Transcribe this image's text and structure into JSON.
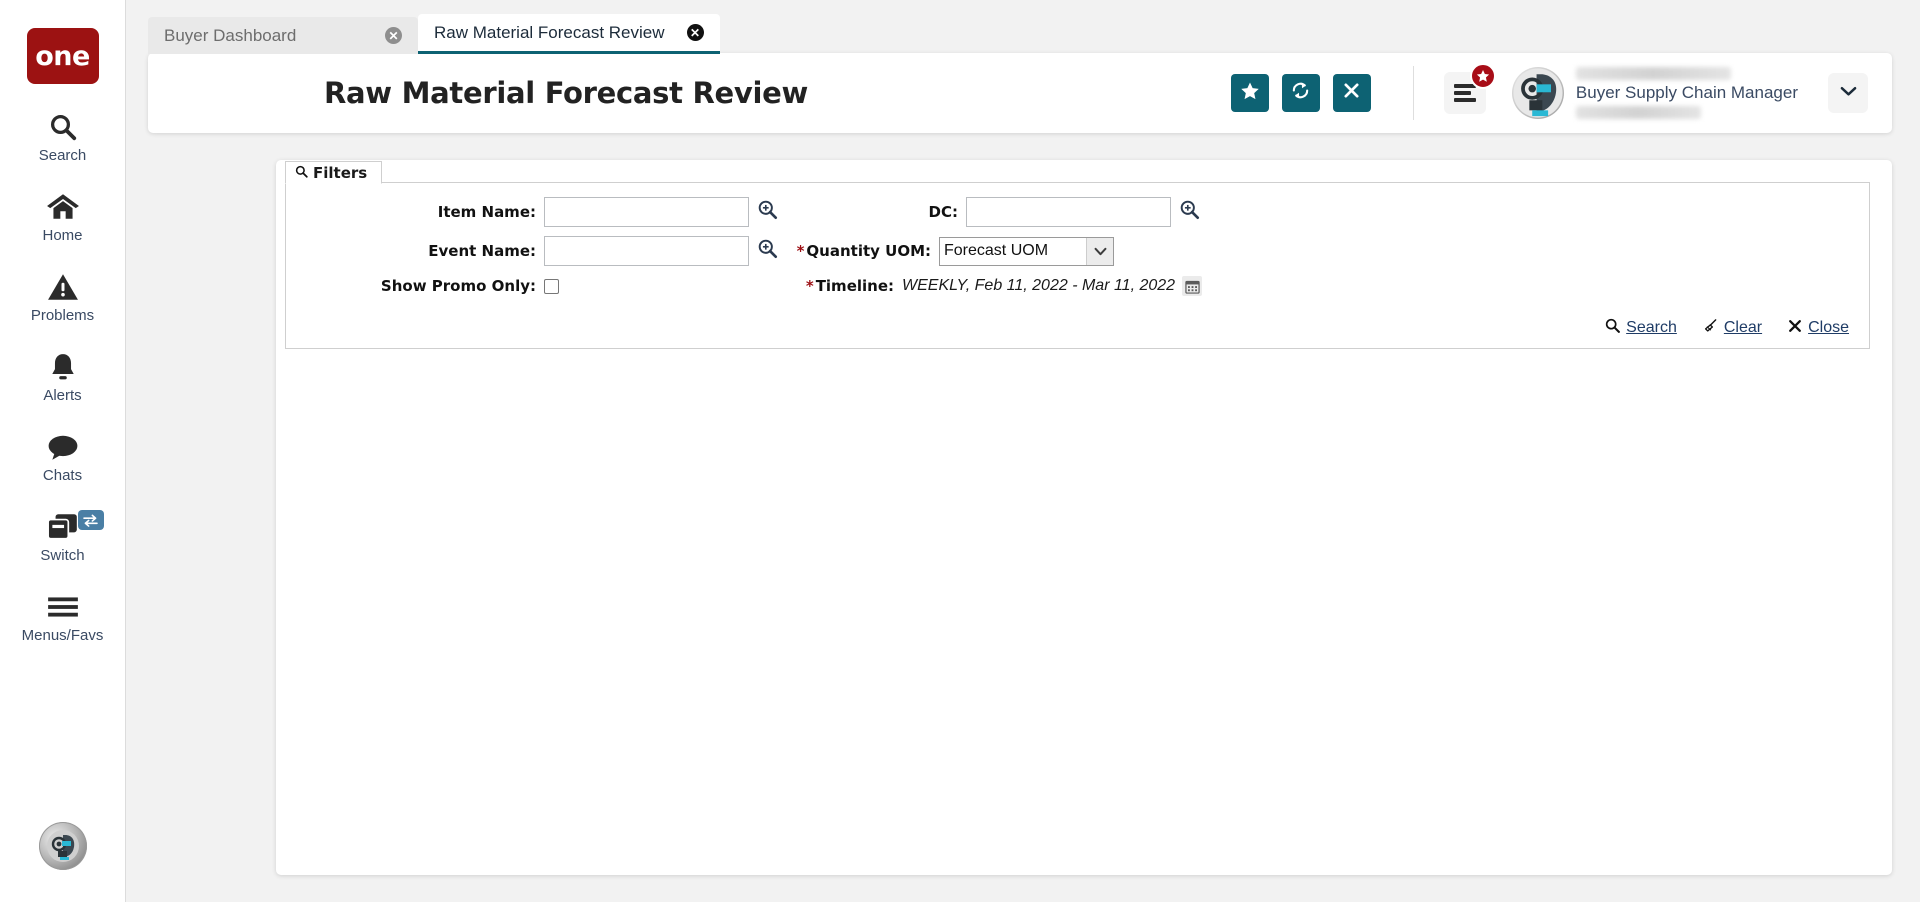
{
  "brand": {
    "logo_text": "one",
    "logo_color": "#9c1212"
  },
  "theme": {
    "accent_teal": "#0d6273",
    "link_blue": "#1f3c66",
    "required_red": "#9c0e13",
    "badge_red": "#a80d17"
  },
  "sidebar": {
    "items": [
      {
        "label": "Search",
        "icon": "search-icon"
      },
      {
        "label": "Home",
        "icon": "home-icon"
      },
      {
        "label": "Problems",
        "icon": "warning-triangle-icon"
      },
      {
        "label": "Alerts",
        "icon": "bell-icon"
      },
      {
        "label": "Chats",
        "icon": "chat-bubble-icon"
      },
      {
        "label": "Switch",
        "icon": "switch-windows-icon",
        "badge_icon": "exchange-arrows-icon"
      },
      {
        "label": "Menus/Favs",
        "icon": "hamburger-icon"
      }
    ],
    "bottom_avatar_icon": "robot-assistant-icon"
  },
  "tabs": [
    {
      "label": "Buyer Dashboard",
      "active": false,
      "close_icon": "close-circle-icon"
    },
    {
      "label": "Raw Material Forecast Review",
      "active": true,
      "close_icon": "close-circle-icon"
    }
  ],
  "header": {
    "title": "Raw Material Forecast Review",
    "actions": [
      {
        "name": "favorite-button",
        "icon": "star-icon"
      },
      {
        "name": "refresh-button",
        "icon": "refresh-icon"
      },
      {
        "name": "close-page-button",
        "icon": "x-icon"
      }
    ],
    "menu_button": {
      "icon": "menu-lines-icon",
      "badge_icon": "star-icon"
    },
    "user": {
      "role": "Buyer Supply Chain Manager",
      "avatar_icon": "robot-avatar-icon",
      "caret_icon": "chevron-down-icon"
    }
  },
  "filters": {
    "panel_label": "Filters",
    "panel_icon": "search-icon",
    "fields": {
      "item_name": {
        "label": "Item Name:",
        "value": "",
        "placeholder": "",
        "lookup_icon": "magnifier-plus-icon"
      },
      "dc": {
        "label": "DC:",
        "value": "",
        "placeholder": "",
        "lookup_icon": "magnifier-plus-icon"
      },
      "event_name": {
        "label": "Event Name:",
        "value": "",
        "placeholder": "",
        "lookup_icon": "magnifier-plus-icon"
      },
      "quantity_uom": {
        "label": "Quantity UOM:",
        "required": true,
        "value": "Forecast UOM",
        "options": [
          "Forecast UOM"
        ],
        "caret_icon": "chevron-down-icon"
      },
      "show_promo_only": {
        "label": "Show Promo Only:",
        "checked": false
      },
      "timeline": {
        "label": "Timeline:",
        "required": true,
        "value": "WEEKLY, Feb 11, 2022 - Mar 11, 2022",
        "calendar_icon": "calendar-icon"
      }
    },
    "actions": [
      {
        "label": "Search",
        "icon": "search-icon"
      },
      {
        "label": "Clear",
        "icon": "broom-icon"
      },
      {
        "label": "Close",
        "icon": "x-icon"
      }
    ]
  }
}
